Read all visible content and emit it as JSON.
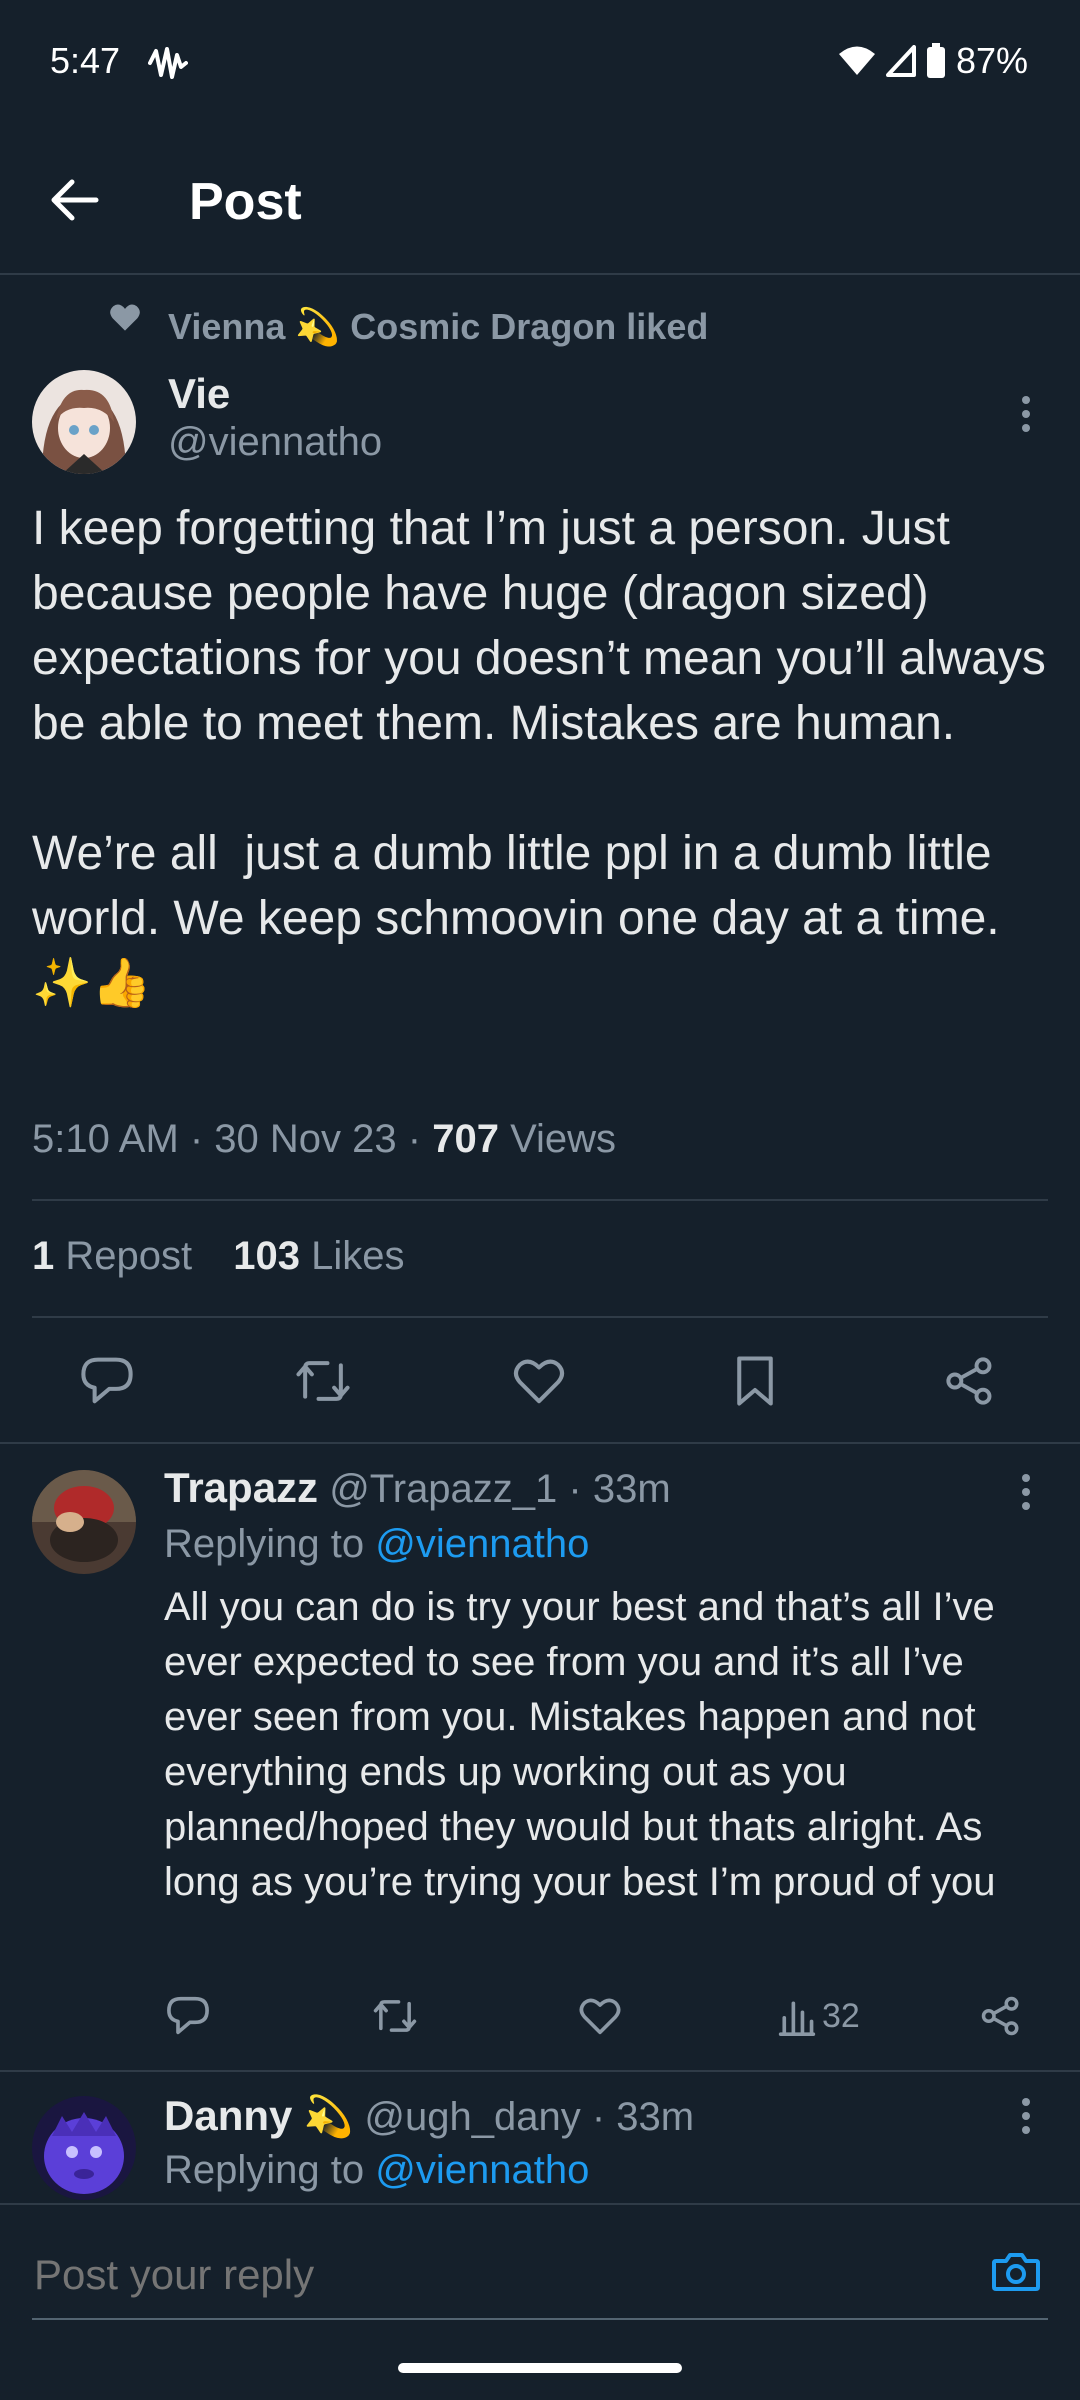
{
  "status_bar": {
    "time": "5:47",
    "battery": "87%"
  },
  "header": {
    "title": "Post"
  },
  "main_post": {
    "social_context_prefix": "Vienna",
    "social_context_emoji": "💫",
    "social_context_suffix": "Cosmic Dragon liked",
    "author_name": "Vie",
    "author_handle": "@viennatho",
    "text": "I keep forgetting that I’m just a person. Just because people have huge (dragon sized) expectations for you doesn’t mean you’ll always be able to meet them. Mistakes are human.\n\nWe’re all  just a dumb little ppl in a dumb little world. We keep schmoovin one day at a time. ✨👍",
    "timestamp": "5:10 AM · 30 Nov 23 · ",
    "views_count": "707",
    "views_label": " Views",
    "reposts_count": "1",
    "reposts_label": " Repost",
    "likes_count": "103",
    "likes_label": " Likes"
  },
  "replies": [
    {
      "author_name": "Trapazz",
      "author_handle": "@Trapazz_1",
      "time": " · 33m",
      "replying_prefix": "Replying to ",
      "replying_handle": "@viennatho",
      "text": "All you can do is try your best and that’s all I’ve ever expected to see from you and it’s all I’ve ever seen from you. Mistakes happen and not everything ends up working out as you planned/hoped they would but thats alright. As long as you’re trying your best I’m proud of you",
      "views": "32"
    },
    {
      "author_name": "Danny",
      "author_emoji": "💫",
      "author_handle": "@ugh_dany",
      "time": " · 33m",
      "replying_prefix": "Replying to ",
      "replying_handle": "@viennatho"
    }
  ],
  "composer": {
    "placeholder": "Post your reply"
  },
  "colors": {
    "background": "#15202b",
    "accent": "#1d9bf0",
    "muted": "#8b98a5",
    "text": "#e7e9ea"
  }
}
